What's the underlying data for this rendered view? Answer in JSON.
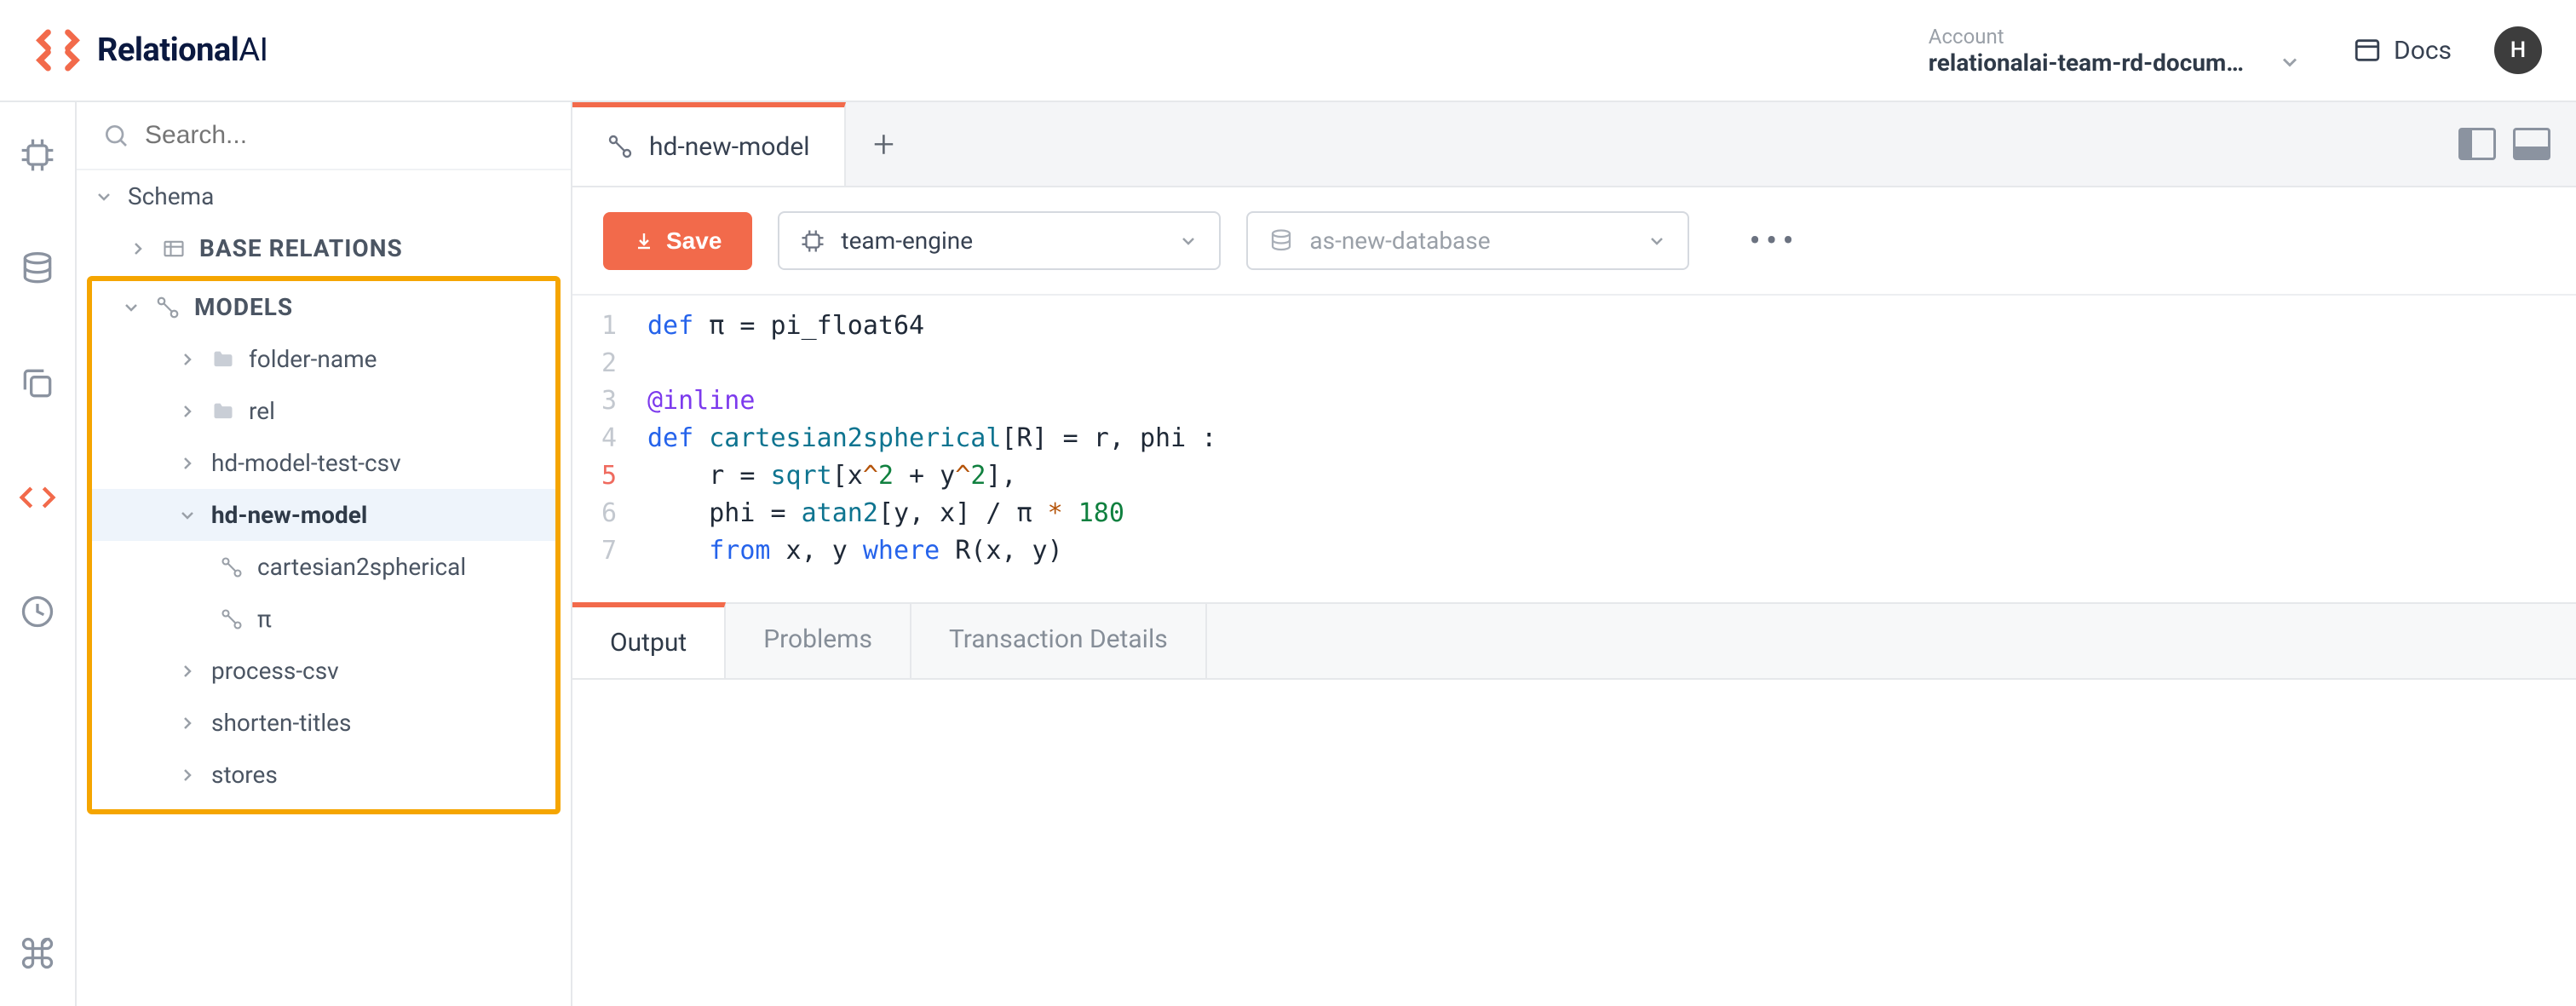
{
  "header": {
    "brand": "RelationalAI",
    "account_label": "Account",
    "account_name": "relationalai-team-rd-docum…",
    "docs_label": "Docs",
    "avatar_initial": "H"
  },
  "explorer": {
    "search_placeholder": "Search...",
    "schema_label": "Schema",
    "base_relations_label": "BASE RELATIONS",
    "models_label": "MODELS",
    "items": {
      "folder_name": "folder-name",
      "rel": "rel",
      "hd_model_test_csv": "hd-model-test-csv",
      "hd_new_model": "hd-new-model",
      "cartesian2spherical": "cartesian2spherical",
      "pi": "π",
      "process_csv": "process-csv",
      "shorten_titles": "shorten-titles",
      "stores": "stores"
    }
  },
  "tabs": {
    "active": "hd-new-model"
  },
  "toolbar": {
    "save_label": "Save",
    "engine_value": "team-engine",
    "database_value": "as-new-database"
  },
  "editor": {
    "lines": [
      "1",
      "2",
      "3",
      "4",
      "5",
      "6",
      "7"
    ],
    "error_line": "5",
    "code_plain": "def π = pi_float64\n\n@inline\ndef cartesian2spherical[R] = r, phi :\n    r = sqrt[x^2 + y^2],\n    phi = atan2[y, x] / π * 180\n    from x, y where R(x, y)"
  },
  "output_tabs": {
    "output": "Output",
    "problems": "Problems",
    "transaction_details": "Transaction Details"
  }
}
